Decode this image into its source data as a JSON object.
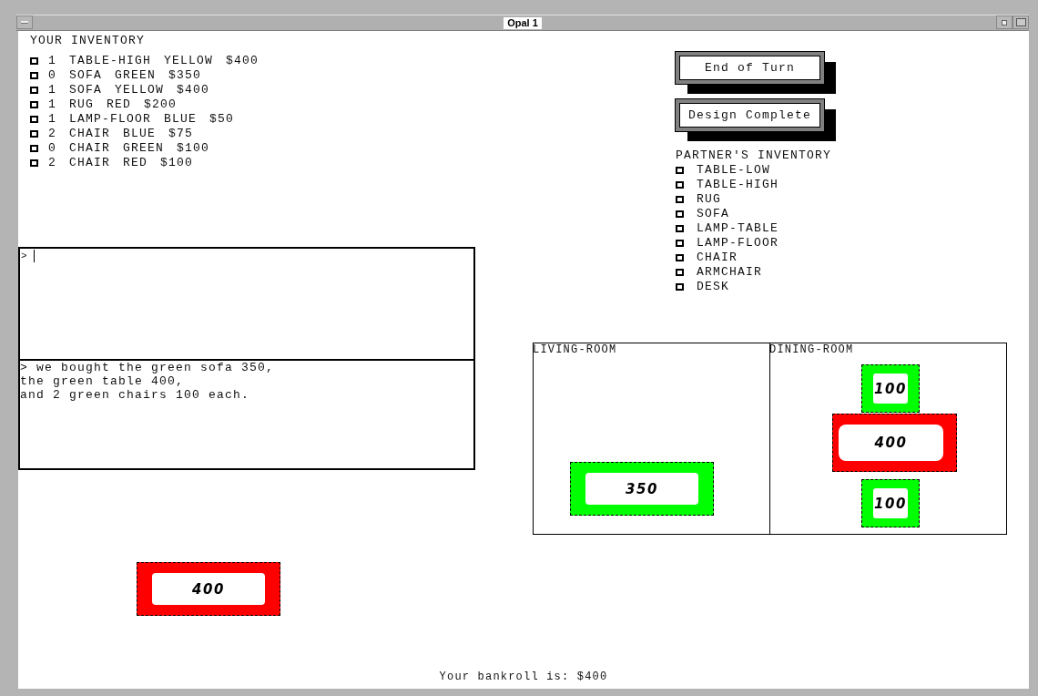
{
  "window": {
    "title": "Opal 1"
  },
  "your_inventory": {
    "title": "YOUR INVENTORY",
    "items": [
      {
        "count": "1",
        "name": "TABLE-HIGH",
        "color_name": "YELLOW",
        "price": "$400"
      },
      {
        "count": "0",
        "name": "SOFA",
        "color_name": "GREEN",
        "price": "$350"
      },
      {
        "count": "1",
        "name": "SOFA",
        "color_name": "YELLOW",
        "price": "$400"
      },
      {
        "count": "1",
        "name": "RUG",
        "color_name": "RED",
        "price": "$200"
      },
      {
        "count": "1",
        "name": "LAMP-FLOOR",
        "color_name": "BLUE",
        "price": "$50"
      },
      {
        "count": "2",
        "name": "CHAIR",
        "color_name": "BLUE",
        "price": "$75"
      },
      {
        "count": "0",
        "name": "CHAIR",
        "color_name": "GREEN",
        "price": "$100"
      },
      {
        "count": "2",
        "name": "CHAIR",
        "color_name": "RED",
        "price": "$100"
      }
    ]
  },
  "input_box": {
    "prompt": ">"
  },
  "message_box": {
    "lines": [
      "> we bought the green sofa 350,",
      "the green table 400,",
      "and 2 green chairs 100 each."
    ]
  },
  "buttons": [
    "End of Turn",
    "Design Complete"
  ],
  "partner_inventory": {
    "title": "PARTNER'S INVENTORY",
    "items": [
      "TABLE-LOW",
      "TABLE-HIGH",
      "RUG",
      "SOFA",
      "LAMP-TABLE",
      "LAMP-FLOOR",
      "CHAIR",
      "ARMCHAIR",
      "DESK"
    ]
  },
  "rooms": [
    {
      "name": "LIVING-ROOM",
      "pieces": [
        {
          "kind": "sofa",
          "price": "350",
          "color": "#00ff00"
        }
      ]
    },
    {
      "name": "DINING-ROOM",
      "pieces": [
        {
          "kind": "chair",
          "price": "100",
          "color": "#00ff00"
        },
        {
          "kind": "table",
          "price": "400",
          "color": "#ff0000"
        },
        {
          "kind": "chair",
          "price": "100",
          "color": "#00ff00"
        }
      ]
    }
  ],
  "loose_pieces": [
    {
      "kind": "sofa",
      "price": "400",
      "color": "#ff0000"
    }
  ],
  "status": "Your bankroll is: $400"
}
